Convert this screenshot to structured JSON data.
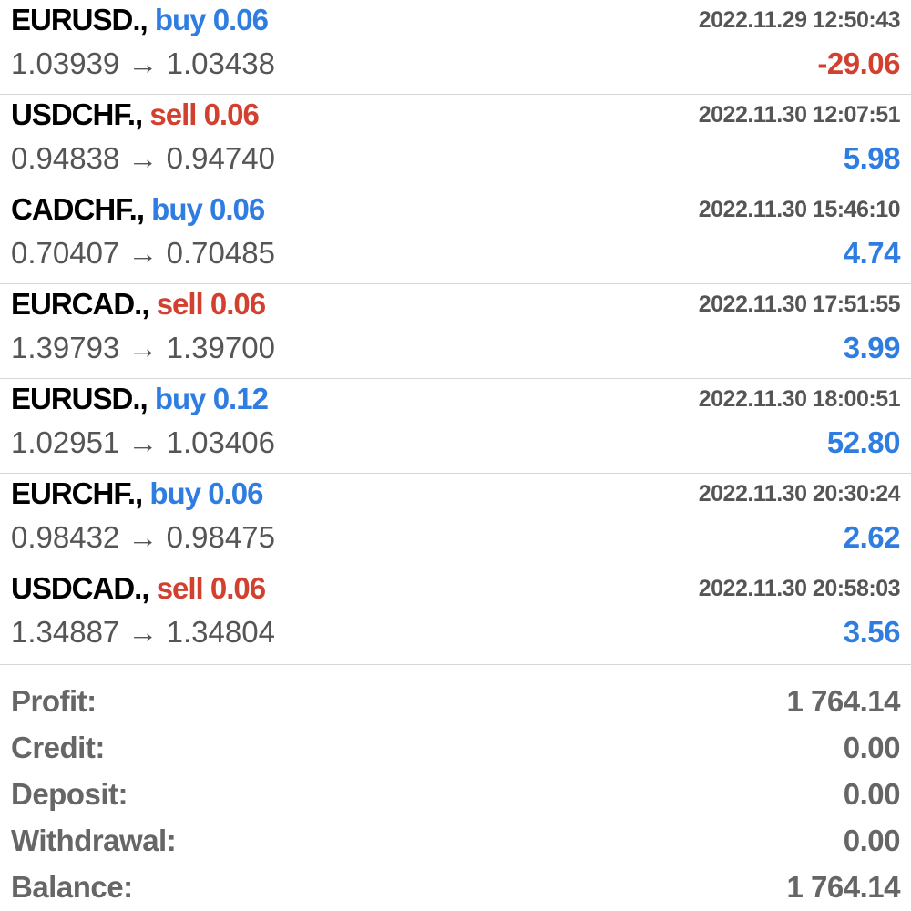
{
  "trades": [
    {
      "symbol": "EURUSD.,",
      "direction": "buy 0.06",
      "side": "buy",
      "time": "2022.11.29 12:50:43",
      "open_price": "1.03939",
      "arrow": "→",
      "close_price": "1.03438",
      "profit": "-29.06",
      "profit_sign": "neg"
    },
    {
      "symbol": "USDCHF.,",
      "direction": "sell 0.06",
      "side": "sell",
      "time": "2022.11.30 12:07:51",
      "open_price": "0.94838",
      "arrow": "→",
      "close_price": "0.94740",
      "profit": "5.98",
      "profit_sign": "pos"
    },
    {
      "symbol": "CADCHF.,",
      "direction": "buy 0.06",
      "side": "buy",
      "time": "2022.11.30 15:46:10",
      "open_price": "0.70407",
      "arrow": "→",
      "close_price": "0.70485",
      "profit": "4.74",
      "profit_sign": "pos"
    },
    {
      "symbol": "EURCAD.,",
      "direction": "sell 0.06",
      "side": "sell",
      "time": "2022.11.30 17:51:55",
      "open_price": "1.39793",
      "arrow": "→",
      "close_price": "1.39700",
      "profit": "3.99",
      "profit_sign": "pos"
    },
    {
      "symbol": "EURUSD.,",
      "direction": "buy 0.12",
      "side": "buy",
      "time": "2022.11.30 18:00:51",
      "open_price": "1.02951",
      "arrow": "→",
      "close_price": "1.03406",
      "profit": "52.80",
      "profit_sign": "pos"
    },
    {
      "symbol": "EURCHF.,",
      "direction": "buy 0.06",
      "side": "buy",
      "time": "2022.11.30 20:30:24",
      "open_price": "0.98432",
      "arrow": "→",
      "close_price": "0.98475",
      "profit": "2.62",
      "profit_sign": "pos"
    },
    {
      "symbol": "USDCAD.,",
      "direction": "sell 0.06",
      "side": "sell",
      "time": "2022.11.30 20:58:03",
      "open_price": "1.34887",
      "arrow": "→",
      "close_price": "1.34804",
      "profit": "3.56",
      "profit_sign": "pos"
    }
  ],
  "summary": {
    "profit_label": "Profit:",
    "profit_value": "1 764.14",
    "credit_label": "Credit:",
    "credit_value": "0.00",
    "deposit_label": "Deposit:",
    "deposit_value": "0.00",
    "withdrawal_label": "Withdrawal:",
    "withdrawal_value": "0.00",
    "balance_label": "Balance:",
    "balance_value": "1 764.14"
  },
  "colors": {
    "buy": "#2f7de1",
    "sell": "#d2402f",
    "profit_positive": "#2f7de1",
    "profit_negative": "#d2402f",
    "muted_text": "#555555"
  }
}
